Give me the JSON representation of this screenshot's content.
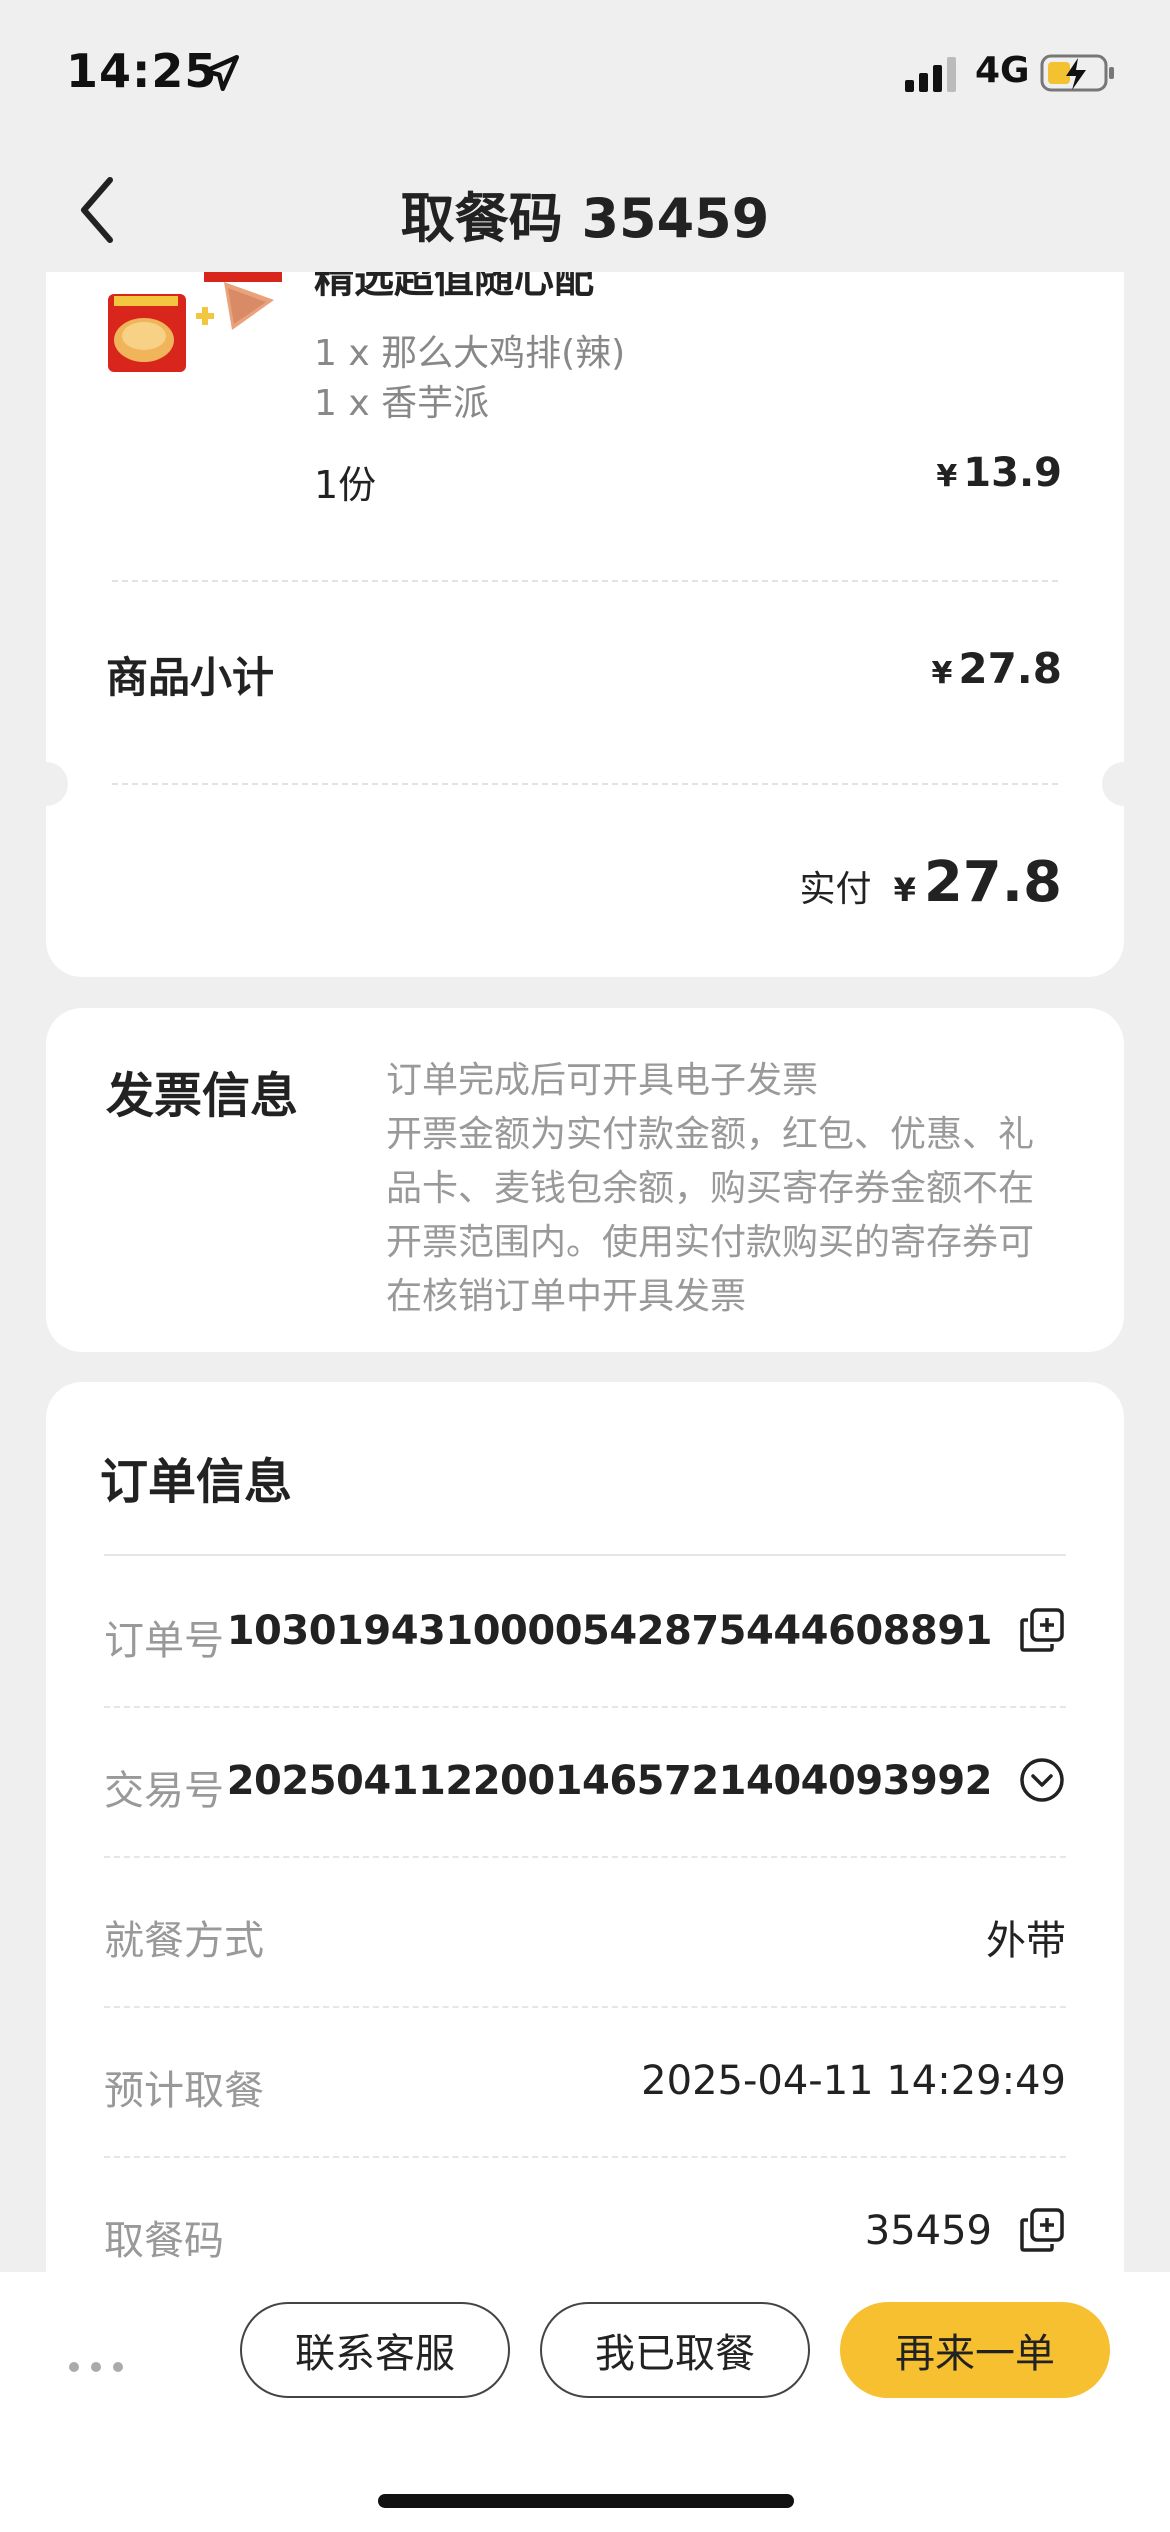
{
  "status_bar": {
    "time": "14:25",
    "network": "4G",
    "icons": [
      "location-arrow-icon",
      "signal-icon",
      "battery-charging-icon"
    ]
  },
  "header": {
    "title": "取餐码 35459",
    "back_icon": "chevron-left-icon"
  },
  "order": {
    "product_name": "精选超值随心配",
    "items": [
      "1 x 那么大鸡排(辣)",
      "1 x 香芋派"
    ],
    "quantity": "1份",
    "price_currency": "¥",
    "price": "13.9",
    "subtotal_label": "商品小计",
    "subtotal_value": "27.8",
    "paid_label": "实付",
    "paid_value": "27.8"
  },
  "invoice": {
    "title": "发票信息",
    "lines": [
      "订单完成后可开具电子发票",
      "开票金额为实付款金额，红包、优惠、礼",
      "品卡、麦钱包余额，购买寄存券金额不在",
      "开票范围内。使用实付款购买的寄存券可",
      "在核销订单中开具发票"
    ]
  },
  "order_info": {
    "title": "订单信息",
    "rows": [
      {
        "label": "订单号",
        "value": "1030194310000542875444608891",
        "icon": "copy-icon"
      },
      {
        "label": "交易号",
        "value": "2025041122001465721404093992",
        "icon": "chevron-down-circle-icon"
      },
      {
        "label": "就餐方式",
        "value": "外带"
      },
      {
        "label": "预计取餐",
        "value": "2025-04-11 14:29:49"
      },
      {
        "label": "取餐码",
        "value": "35459",
        "icon": "copy-icon"
      }
    ]
  },
  "bottom_bar": {
    "more_icon": "more-dots-icon",
    "service_button": "联系客服",
    "picked_button": "我已取餐",
    "again_button": "再来一单"
  },
  "colors": {
    "background": "#efefef",
    "accent": "#f7c031",
    "muted_text": "#999999"
  }
}
